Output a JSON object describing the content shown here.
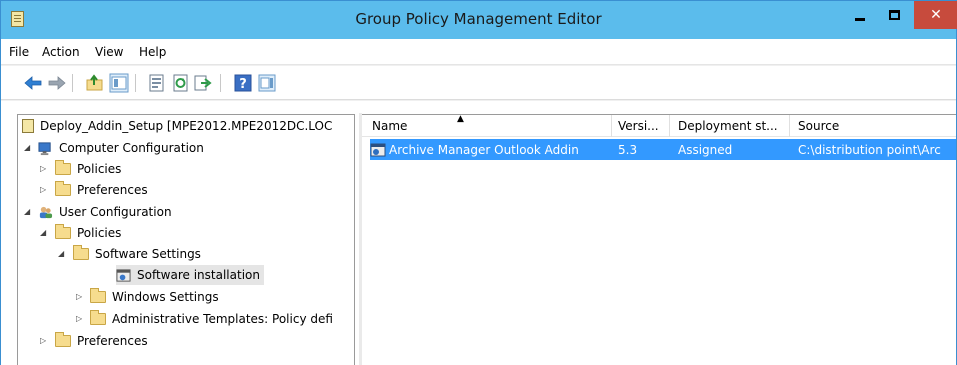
{
  "window": {
    "title": "Group Policy Management Editor"
  },
  "menu": {
    "file": "File",
    "action": "Action",
    "view": "View",
    "help": "Help"
  },
  "toolbar": {
    "buttons": [
      "back-arrow-icon",
      "forward-arrow-icon",
      "up-folder-icon",
      "show-hide-console-tree-icon",
      "properties-icon",
      "refresh-icon",
      "export-list-icon",
      "help-icon",
      "show-action-pane-icon"
    ]
  },
  "tree": {
    "root": "Deploy_Addin_Setup [MPE2012.MPE2012DC.LOC",
    "computer_config": "Computer Configuration",
    "cc_policies": "Policies",
    "cc_preferences": "Preferences",
    "user_config": "User Configuration",
    "uc_policies": "Policies",
    "software_settings": "Software Settings",
    "software_installation": "Software installation",
    "windows_settings": "Windows Settings",
    "admin_templates": "Administrative Templates: Policy defi",
    "uc_preferences": "Preferences"
  },
  "list": {
    "columns": {
      "name": "Name",
      "version": "Versi...",
      "deployment": "Deployment st...",
      "source": "Source"
    },
    "rows": [
      {
        "name": "Archive Manager Outlook Addin",
        "version": "5.3",
        "deployment": "Assigned",
        "source": "C:\\distribution point\\Arc"
      }
    ]
  },
  "colors": {
    "titlebar": "#5bbcec",
    "close_button": "#c74b3d",
    "selection": "#3399ff"
  }
}
